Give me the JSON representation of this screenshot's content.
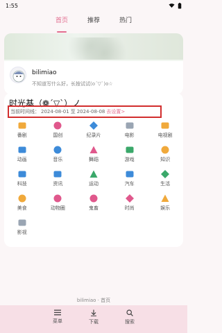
{
  "status": {
    "time": "1:55"
  },
  "tabs": [
    {
      "label": "首页",
      "active": true
    },
    {
      "label": "推荐",
      "active": false
    },
    {
      "label": "热门",
      "active": false
    }
  ],
  "profile": {
    "username": "bilimiao",
    "signature": "不知道写什么好，长按试试(o´▽`)o☆"
  },
  "main": {
    "title": "时光基（❁´▽`）ノ",
    "date_prefix": "当前时间线：",
    "date_start": "2024-08-01",
    "date_sep": "至",
    "date_end": "2024-08-08",
    "date_link": "去设置>"
  },
  "categories": [
    {
      "label": "番剧",
      "icon": "bangumi-icon",
      "color": "#f0a93b"
    },
    {
      "label": "国创",
      "icon": "guochuang-icon",
      "color": "#e0588c"
    },
    {
      "label": "纪录片",
      "icon": "documentary-icon",
      "color": "#3d8bd9"
    },
    {
      "label": "电影",
      "icon": "movie-icon",
      "color": "#9aa5b3"
    },
    {
      "label": "电视剧",
      "icon": "tv-icon",
      "color": "#f0a93b"
    },
    {
      "label": "动画",
      "icon": "animation-icon",
      "color": "#3d8bd9"
    },
    {
      "label": "音乐",
      "icon": "music-icon",
      "color": "#3d8bd9"
    },
    {
      "label": "舞蹈",
      "icon": "dance-icon",
      "color": "#e0588c"
    },
    {
      "label": "游戏",
      "icon": "game-icon",
      "color": "#3aa86a"
    },
    {
      "label": "知识",
      "icon": "knowledge-icon",
      "color": "#f0a93b"
    },
    {
      "label": "科技",
      "icon": "tech-icon",
      "color": "#3d8bd9"
    },
    {
      "label": "资讯",
      "icon": "news-icon",
      "color": "#3d8bd9"
    },
    {
      "label": "运动",
      "icon": "sports-icon",
      "color": "#3aa86a"
    },
    {
      "label": "汽车",
      "icon": "car-icon",
      "color": "#3d8bd9"
    },
    {
      "label": "生活",
      "icon": "life-icon",
      "color": "#3aa86a"
    },
    {
      "label": "美食",
      "icon": "food-icon",
      "color": "#f0a93b"
    },
    {
      "label": "动物圈",
      "icon": "animal-icon",
      "color": "#e0588c"
    },
    {
      "label": "鬼畜",
      "icon": "kichiku-icon",
      "color": "#e0588c"
    },
    {
      "label": "时尚",
      "icon": "fashion-icon",
      "color": "#e0588c"
    },
    {
      "label": "娱乐",
      "icon": "entertainment-icon",
      "color": "#f0a93b"
    },
    {
      "label": "影视",
      "icon": "film-icon",
      "color": "#9aa5b3"
    }
  ],
  "footer": {
    "title": "bilimiao · 首页"
  },
  "bottom_nav": [
    {
      "label": "菜单",
      "icon": "menu-icon"
    },
    {
      "label": "下载",
      "icon": "download-icon"
    },
    {
      "label": "搜索",
      "icon": "search-icon"
    }
  ],
  "colors": {
    "accent": "#e26d8f",
    "highlight_border": "#d22d2d",
    "nav_bg": "#f7dfe6"
  }
}
